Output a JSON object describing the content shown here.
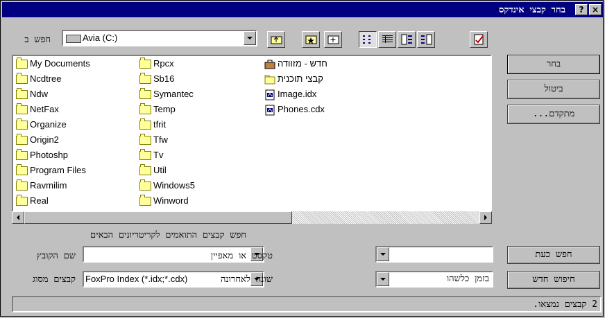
{
  "window": {
    "title": "בחר קבצי אינדקס",
    "help_label": "?",
    "close_label": "×"
  },
  "lookin": {
    "label": "חפש ב",
    "drive": "Avia (C:)"
  },
  "files": {
    "col1": [
      "My Documents",
      "Ncdtree",
      "Ndw",
      "NetFax",
      "Organize",
      "Origin2",
      "Photoshp",
      "Program Files",
      "Ravmilim",
      "Real"
    ],
    "col2": [
      "Rpcx",
      "Sb16",
      "Symantec",
      "Temp",
      "tfrit",
      "Tfw",
      "Tv",
      "Util",
      "Windows5",
      "Winword"
    ],
    "col3": [
      {
        "name": "חדש - מזוודה",
        "icon": "briefcase-icon"
      },
      {
        "name": "קבצי תוכנית",
        "icon": "folder-icon"
      },
      {
        "name": "Image.idx",
        "icon": "index-file-icon"
      },
      {
        "name": "Phones.cdx",
        "icon": "index-file-icon"
      }
    ]
  },
  "buttons": {
    "select": "בחר",
    "cancel": "ביטול",
    "advanced": "מתקדם...",
    "find_now": "חפש כעת",
    "new_search": "חיפוש חדש"
  },
  "criteria": {
    "heading": "חפש קבצים התואמים לקריטריונים הבאים",
    "filename_label": "שם הקובץ",
    "filename_value": "",
    "text_label": "טקסט או מאפיין",
    "text_value": "",
    "filetype_label": "קבצים מסוג",
    "filetype_value": "FoxPro Index (*.idx;*.cdx)",
    "modified_label": "שונה לאחרונה",
    "modified_value": "בזמן כלשהו"
  },
  "status": {
    "text": "2 קבצים נמצאו."
  }
}
